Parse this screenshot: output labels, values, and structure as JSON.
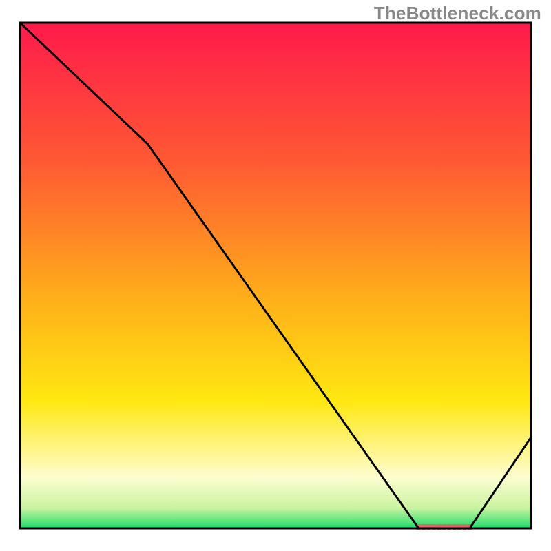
{
  "watermark": "TheBottleneck.com",
  "chart_data": {
    "type": "line",
    "title": "",
    "xlabel": "",
    "ylabel": "",
    "xlim": [
      0,
      100
    ],
    "ylim": [
      0,
      100
    ],
    "x": [
      0,
      25,
      78,
      88,
      100
    ],
    "values": [
      100,
      76,
      0,
      0,
      18
    ],
    "gradient_stops": [
      {
        "offset": 0.0,
        "color": "#ff1a4b"
      },
      {
        "offset": 0.28,
        "color": "#ff5a33"
      },
      {
        "offset": 0.55,
        "color": "#ffb019"
      },
      {
        "offset": 0.75,
        "color": "#ffe812"
      },
      {
        "offset": 0.9,
        "color": "#fdfdd0"
      },
      {
        "offset": 0.96,
        "color": "#c9f3a0"
      },
      {
        "offset": 1.0,
        "color": "#1edc6a"
      }
    ],
    "marker": {
      "x_start": 78,
      "x_end": 88,
      "y": 0,
      "color": "#e06666"
    },
    "axis_color": "#000000",
    "grid": false
  }
}
